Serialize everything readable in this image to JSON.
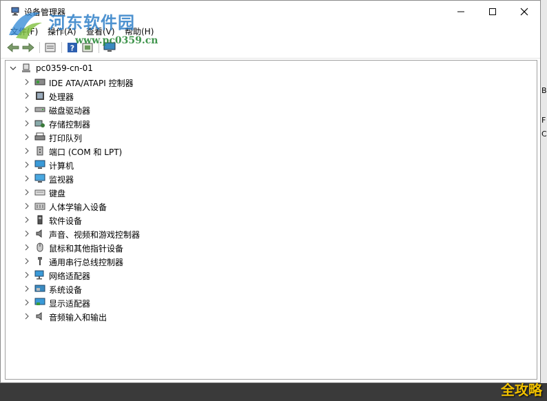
{
  "window": {
    "title": "设备管理器",
    "icon": "device-manager-icon"
  },
  "menu": [
    "文件(F)",
    "操作(A)",
    "查看(V)",
    "帮助(H)"
  ],
  "watermark": {
    "logo_text": "河东软件园",
    "url": "www.pc0359.cn"
  },
  "toolbar": {
    "buttons": [
      "back-arrow-icon",
      "forward-arrow-icon",
      "properties-icon",
      "help-icon",
      "update-driver-icon",
      "monitor-scan-icon"
    ]
  },
  "tree": {
    "root": "pc0359-cn-01",
    "items": [
      {
        "label": "IDE ATA/ATAPI 控制器",
        "icon": "ide-controller-icon"
      },
      {
        "label": "处理器",
        "icon": "processor-icon"
      },
      {
        "label": "磁盘驱动器",
        "icon": "disk-drive-icon"
      },
      {
        "label": "存储控制器",
        "icon": "storage-controller-icon"
      },
      {
        "label": "打印队列",
        "icon": "printer-icon"
      },
      {
        "label": "端口 (COM 和 LPT)",
        "icon": "port-icon"
      },
      {
        "label": "计算机",
        "icon": "computer-icon"
      },
      {
        "label": "监视器",
        "icon": "monitor-icon"
      },
      {
        "label": "键盘",
        "icon": "keyboard-icon"
      },
      {
        "label": "人体学输入设备",
        "icon": "hid-icon"
      },
      {
        "label": "软件设备",
        "icon": "software-device-icon"
      },
      {
        "label": "声音、视频和游戏控制器",
        "icon": "sound-icon"
      },
      {
        "label": "鼠标和其他指针设备",
        "icon": "mouse-icon"
      },
      {
        "label": "通用串行总线控制器",
        "icon": "usb-icon"
      },
      {
        "label": "网络适配器",
        "icon": "network-adapter-icon"
      },
      {
        "label": "系统设备",
        "icon": "system-device-icon"
      },
      {
        "label": "显示适配器",
        "icon": "display-adapter-icon"
      },
      {
        "label": "音频输入和输出",
        "icon": "audio-io-icon"
      }
    ]
  },
  "corner_badge": "全攻略"
}
